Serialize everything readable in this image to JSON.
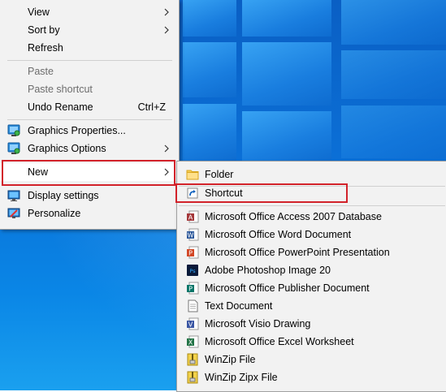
{
  "context_menu": {
    "items": {
      "view": {
        "label": "View"
      },
      "sort_by": {
        "label": "Sort by"
      },
      "refresh": {
        "label": "Refresh"
      },
      "paste": {
        "label": "Paste"
      },
      "paste_shortcut": {
        "label": "Paste shortcut"
      },
      "undo_rename": {
        "label": "Undo Rename",
        "shortcut": "Ctrl+Z"
      },
      "graphics_properties": {
        "label": "Graphics Properties..."
      },
      "graphics_options": {
        "label": "Graphics Options"
      },
      "new": {
        "label": "New"
      },
      "display_settings": {
        "label": "Display settings"
      },
      "personalize": {
        "label": "Personalize"
      }
    }
  },
  "new_submenu": {
    "items": [
      {
        "label": "Folder",
        "icon": "folder-icon"
      },
      {
        "label": "Shortcut",
        "icon": "shortcut-icon"
      },
      {
        "label": "Microsoft Office Access 2007 Database",
        "icon": "access-icon"
      },
      {
        "label": "Microsoft Office Word Document",
        "icon": "word-icon"
      },
      {
        "label": "Microsoft Office PowerPoint Presentation",
        "icon": "powerpoint-icon"
      },
      {
        "label": "Adobe Photoshop Image 20",
        "icon": "photoshop-icon"
      },
      {
        "label": "Microsoft Office Publisher Document",
        "icon": "publisher-icon"
      },
      {
        "label": "Text Document",
        "icon": "text-document-icon"
      },
      {
        "label": "Microsoft Visio Drawing",
        "icon": "visio-icon"
      },
      {
        "label": "Microsoft Office Excel Worksheet",
        "icon": "excel-icon"
      },
      {
        "label": "WinZip File",
        "icon": "winzip-icon"
      },
      {
        "label": "WinZip Zipx File",
        "icon": "winzip-zipx-icon"
      }
    ]
  },
  "colors": {
    "highlight_border": "#d2222a",
    "menu_background": "#f2f2f2",
    "desktop_blue": "#0a6fd6"
  }
}
